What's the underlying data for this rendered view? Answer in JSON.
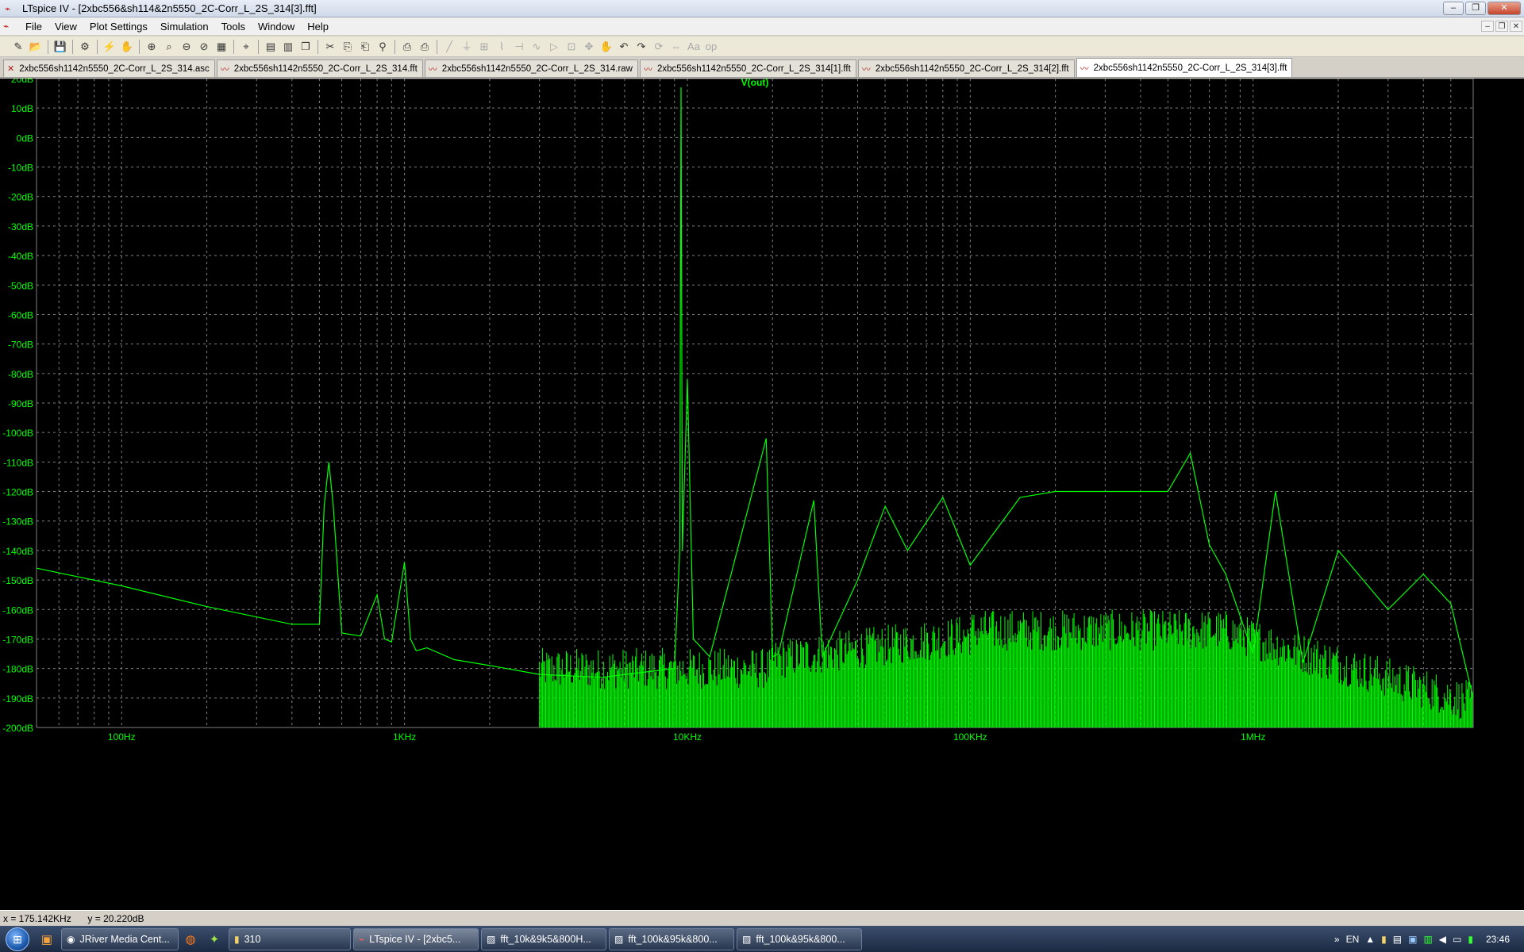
{
  "window": {
    "title": "LTspice IV - [2xbc556&sh114&2n5550_2C-Corr_L_2S_314[3].fft]",
    "buttons": [
      "–",
      "❐",
      "✕"
    ]
  },
  "menu": [
    "File",
    "View",
    "Plot Settings",
    "Simulation",
    "Tools",
    "Window",
    "Help"
  ],
  "mdi_buttons": [
    "–",
    "❐",
    "✕"
  ],
  "toolbar": {
    "icons": [
      "new-schematic-icon",
      "open-icon",
      "save-icon",
      "control-panel-icon",
      "run-icon",
      "halt-icon",
      "zoom-in-icon",
      "zoom-area-icon",
      "zoom-out-icon",
      "zoom-fit-icon",
      "autorange-icon",
      "cursor-icon",
      "tile-horizontal-icon",
      "tile-vertical-icon",
      "cascade-icon",
      "cut-icon",
      "copy-icon",
      "paste-icon",
      "find-icon",
      "print-preview-icon",
      "print-icon",
      "wire-icon",
      "ground-icon",
      "label-icon",
      "resistor-icon",
      "capacitor-icon",
      "inductor-icon",
      "diode-icon",
      "component-icon",
      "move-icon",
      "drag-icon",
      "undo-icon",
      "redo-icon",
      "rotate-icon",
      "mirror-icon",
      "text-icon",
      "spice-directive-icon"
    ]
  },
  "tabs": [
    {
      "label": "2xbc556sh1142n5550_2C-Corr_L_2S_314.asc",
      "kind": "schematic"
    },
    {
      "label": "2xbc556sh1142n5550_2C-Corr_L_2S_314.fft",
      "kind": "plot"
    },
    {
      "label": "2xbc556sh1142n5550_2C-Corr_L_2S_314.raw",
      "kind": "plot"
    },
    {
      "label": "2xbc556sh1142n5550_2C-Corr_L_2S_314[1].fft",
      "kind": "plot"
    },
    {
      "label": "2xbc556sh1142n5550_2C-Corr_L_2S_314[2].fft",
      "kind": "plot"
    },
    {
      "label": "2xbc556sh1142n5550_2C-Corr_L_2S_314[3].fft",
      "kind": "plot",
      "active": true
    }
  ],
  "status": {
    "x": "x = 175.142KHz",
    "y": "y = 20.220dB"
  },
  "taskbar": {
    "buttons": [
      {
        "label": "JRiver Media Cent...",
        "icon": "media-icon"
      },
      {
        "label": "310",
        "icon": "folder-icon"
      },
      {
        "label": "LTspice IV - [2xbc5...",
        "icon": "ltspice-icon",
        "active": true
      },
      {
        "label": "fft_10k&9k5&800H...",
        "icon": "image-icon"
      },
      {
        "label": "fft_100k&95k&800...",
        "icon": "image-icon"
      },
      {
        "label": "fft_100k&95k&800...",
        "icon": "image-icon"
      }
    ],
    "lang": "EN",
    "clock": "23:46"
  },
  "colors": {
    "trace": "#00ff00",
    "grid": "#808080",
    "background": "#000000",
    "label": "#00ff00"
  },
  "chart_data": {
    "type": "line",
    "title": "V(out)",
    "xscale": "log",
    "xlim": [
      50,
      6000000
    ],
    "ylim": [
      -200,
      20
    ],
    "grid": true,
    "x_ticks": [
      "100Hz",
      "1KHz",
      "10KHz",
      "100KHz",
      "1MHz"
    ],
    "y_ticks": [
      "20dB",
      "10dB",
      "0dB",
      "-10dB",
      "-20dB",
      "-30dB",
      "-40dB",
      "-50dB",
      "-60dB",
      "-70dB",
      "-80dB",
      "-90dB",
      "-100dB",
      "-110dB",
      "-120dB",
      "-130dB",
      "-140dB",
      "-150dB",
      "-160dB",
      "-170dB",
      "-180dB",
      "-190dB",
      "-200dB"
    ],
    "series": [
      {
        "name": "V(out)",
        "x": [
          50,
          100,
          200,
          400,
          500,
          520,
          540,
          560,
          600,
          700,
          800,
          850,
          900,
          1000,
          1050,
          1100,
          1200,
          1500,
          2000,
          3000,
          5000,
          9000,
          9400,
          9500,
          9600,
          10000,
          10500,
          12000,
          19000,
          20000,
          21000,
          28000,
          30000,
          40000,
          50000,
          60000,
          80000,
          100000,
          150000,
          200000,
          300000,
          400000,
          500000,
          600000,
          700000,
          800000,
          1000000,
          1200000,
          1500000,
          2000000,
          3000000,
          4000000,
          5000000,
          6000000
        ],
        "y": [
          -146,
          -152,
          -159,
          -165,
          -165,
          -125,
          -110,
          -125,
          -168,
          -169,
          -155,
          -170,
          -171,
          -144,
          -170,
          -174,
          -173,
          -177,
          -179,
          -182,
          -183,
          -180,
          -140,
          17,
          -140,
          -82,
          -170,
          -176,
          -102,
          -176,
          -175,
          -123,
          -176,
          -150,
          -125,
          -140,
          -122,
          -145,
          -122,
          -120,
          -120,
          -120,
          -120,
          -107,
          -138,
          -148,
          -175,
          -120,
          -178,
          -140,
          -160,
          -148,
          -158,
          -190
        ]
      }
    ]
  }
}
